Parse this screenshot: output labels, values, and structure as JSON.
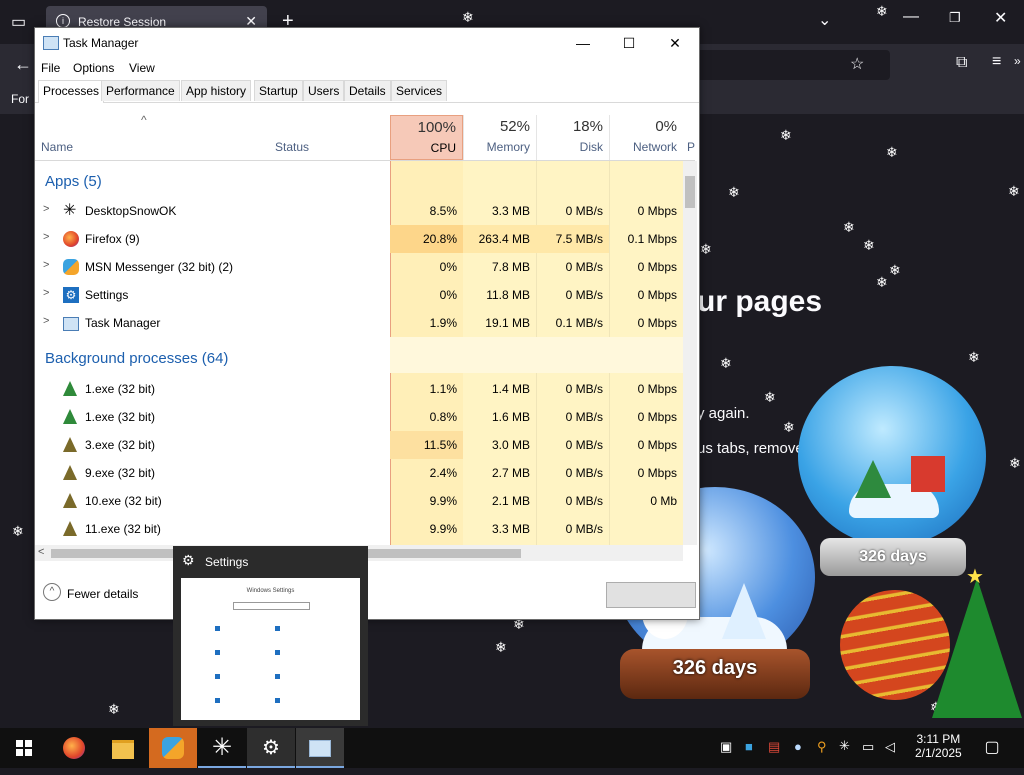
{
  "firefox": {
    "tab_title": "Restore Session",
    "tab_close": "✕",
    "new_tab": "+",
    "toolbar_left": "For",
    "heading_fragment": "ur pages",
    "line1_fragment": "y again.",
    "line2_fragment": "us tabs, remove"
  },
  "task_manager": {
    "title": "Task Manager",
    "menu": [
      "File",
      "Options",
      "View"
    ],
    "tabs": [
      "Processes",
      "Performance",
      "App history",
      "Startup",
      "Users",
      "Details",
      "Services"
    ],
    "columns": {
      "name": "Name",
      "status": "Status",
      "cpu": {
        "pct": "100%",
        "label": "CPU"
      },
      "memory": {
        "pct": "52%",
        "label": "Memory"
      },
      "disk": {
        "pct": "18%",
        "label": "Disk"
      },
      "network": {
        "pct": "0%",
        "label": "Network"
      },
      "more": "P"
    },
    "groups": {
      "apps": "Apps (5)",
      "background": "Background processes (64)"
    },
    "apps": [
      {
        "name": "DesktopSnowOK",
        "cpu": "8.5%",
        "memory": "3.3 MB",
        "disk": "0 MB/s",
        "network": "0 Mbps",
        "icon": "snowflake-icon"
      },
      {
        "name": "Firefox (9)",
        "cpu": "20.8%",
        "memory": "263.4 MB",
        "disk": "7.5 MB/s",
        "network": "0.1 Mbps",
        "icon": "firefox-icon"
      },
      {
        "name": "MSN Messenger (32 bit) (2)",
        "cpu": "0%",
        "memory": "7.8 MB",
        "disk": "0 MB/s",
        "network": "0 Mbps",
        "icon": "messenger-icon"
      },
      {
        "name": "Settings",
        "cpu": "0%",
        "memory": "11.8 MB",
        "disk": "0 MB/s",
        "network": "0 Mbps",
        "icon": "settings-gear-icon"
      },
      {
        "name": "Task Manager",
        "cpu": "1.9%",
        "memory": "19.1 MB",
        "disk": "0.1 MB/s",
        "network": "0 Mbps",
        "icon": "task-manager-icon"
      }
    ],
    "background": [
      {
        "name": "1.exe (32 bit)",
        "cpu": "1.1%",
        "memory": "1.4 MB",
        "disk": "0 MB/s",
        "network": "0 Mbps",
        "icon": "tree-icon"
      },
      {
        "name": "1.exe (32 bit)",
        "cpu": "0.8%",
        "memory": "1.6 MB",
        "disk": "0 MB/s",
        "network": "0 Mbps",
        "icon": "tree-icon"
      },
      {
        "name": "3.exe (32 bit)",
        "cpu": "11.5%",
        "memory": "3.0 MB",
        "disk": "0 MB/s",
        "network": "0 Mbps",
        "icon": "tree-icon"
      },
      {
        "name": "9.exe (32 bit)",
        "cpu": "2.4%",
        "memory": "2.7 MB",
        "disk": "0 MB/s",
        "network": "0 Mbps",
        "icon": "tree-icon"
      },
      {
        "name": "10.exe (32 bit)",
        "cpu": "9.9%",
        "memory": "2.1 MB",
        "disk": "0 MB/s",
        "network": "0 Mb",
        "icon": "tree-icon"
      },
      {
        "name": "11.exe (32 bit)",
        "cpu": "9.9%",
        "memory": "3.3 MB",
        "disk": "0 MB/s",
        "network": "",
        "icon": "tree-icon"
      }
    ],
    "footer": {
      "fewer_details": "Fewer details"
    }
  },
  "settings_preview": {
    "title": "Settings",
    "thumb_heading": "Windows Settings"
  },
  "globes": {
    "left_days": "326 days",
    "right_days": "326 days"
  },
  "clock": {
    "time": "3:11 PM",
    "date": "2/1/2025"
  },
  "colors": {
    "firefox_bg": "#1c1b22",
    "cpu_header_bg": "#f6c9b8",
    "heat_light": "#fff4c4",
    "heat_medium": "#ffe8a8",
    "heat_strong": "#fdd68a",
    "group_text": "#1c5fae"
  }
}
